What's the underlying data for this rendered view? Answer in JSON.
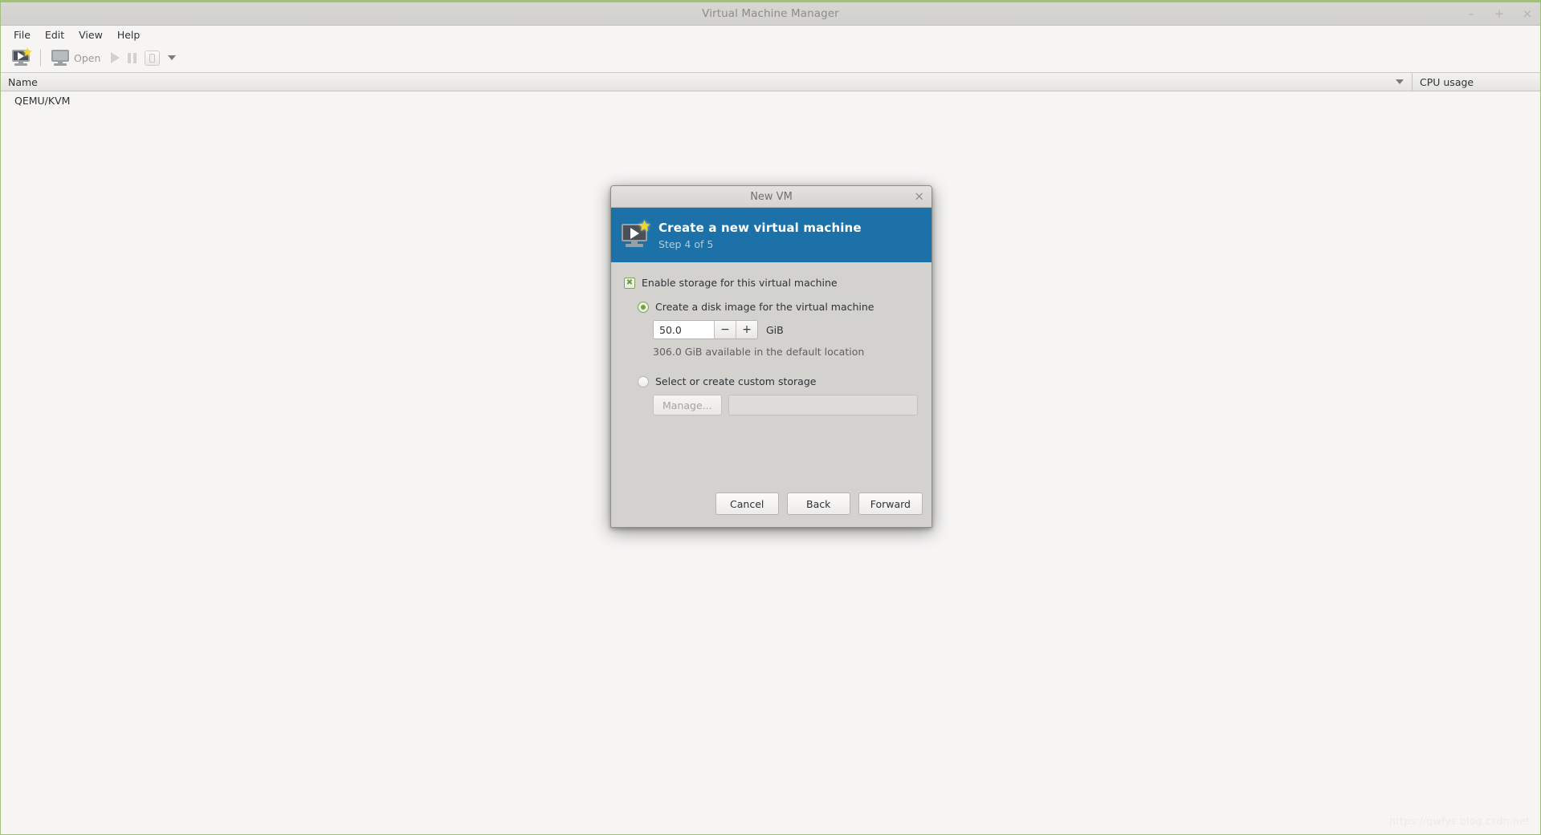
{
  "window": {
    "title": "Virtual Machine Manager",
    "controls": [
      {
        "name": "minimize-button",
        "glyph": "–"
      },
      {
        "name": "maximize-button",
        "glyph": "+"
      },
      {
        "name": "close-button",
        "glyph": "×"
      }
    ]
  },
  "menubar": {
    "items": [
      {
        "label": "File"
      },
      {
        "label": "Edit"
      },
      {
        "label": "View"
      },
      {
        "label": "Help"
      }
    ]
  },
  "toolbar": {
    "new_vm_icon": "new-virtual-machine-icon",
    "open_label": "Open",
    "open_icon": "monitor-icon",
    "run_icon": "play-icon",
    "pause_icon": "pause-icon",
    "shutdown_icon": "shutdown-icon",
    "menu_icon": "chevron-down-icon"
  },
  "list": {
    "columns": [
      {
        "label": "Name"
      },
      {
        "label": "CPU usage"
      }
    ],
    "sort_icon": "chevron-down-icon",
    "rows": [
      {
        "name": "QEMU/KVM",
        "cpu": ""
      }
    ]
  },
  "watermark": "https://qwfys.blog.csdn.net",
  "dialog": {
    "title": "New VM",
    "close_glyph": "×",
    "banner": {
      "heading": "Create a new virtual machine",
      "step": "Step 4 of 5",
      "icon": "new-virtual-machine-icon",
      "background_color": "#1c72a8"
    },
    "enable_storage": {
      "label": "Enable storage for this virtual machine",
      "checked": true,
      "check_glyph": "☒"
    },
    "create_disk": {
      "label": "Create a disk image for the virtual machine",
      "selected": true,
      "size_value": "50.0",
      "decrement_glyph": "−",
      "increment_glyph": "+",
      "unit": "GiB",
      "availability": "306.0 GiB available in the default location"
    },
    "custom_storage": {
      "label": "Select or create custom storage",
      "selected": false,
      "manage_label": "Manage...",
      "path_value": "",
      "path_placeholder": ""
    },
    "buttons": [
      {
        "name": "cancel-button",
        "label": "Cancel"
      },
      {
        "name": "back-button",
        "label": "Back"
      },
      {
        "name": "forward-button",
        "label": "Forward"
      }
    ],
    "accent_color": "#1c72a8",
    "check_color": "#75a144"
  }
}
